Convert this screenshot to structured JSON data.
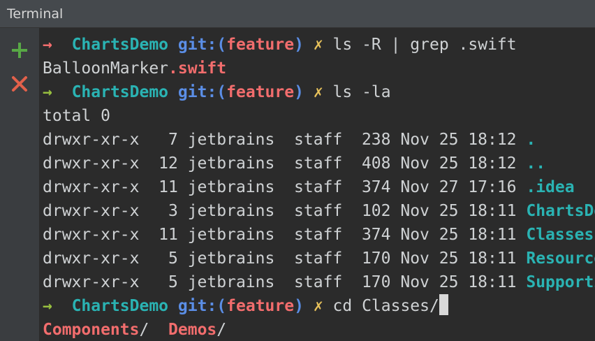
{
  "window": {
    "title": "Terminal"
  },
  "sidebar": {
    "add_icon": "plus-icon",
    "close_icon": "close-icon",
    "add_color": "#58a846",
    "close_color": "#e2614b"
  },
  "prompt": {
    "arrow": "→",
    "repo": "ChartsDemo",
    "git_label": "git:(",
    "branch": "feature",
    "git_close": ")",
    "dirty_mark": "✗"
  },
  "lines": {
    "cmd1": "ls -R | grep .swift",
    "out1_base": "BalloonMarker",
    "out1_ext": ".swift",
    "cmd2": "ls -la",
    "total": "total 0",
    "rows": [
      {
        "perms": "drwxr-xr-x   7 jetbrains  staff  238 Nov 25 18:12 ",
        "name": "."
      },
      {
        "perms": "drwxr-xr-x  12 jetbrains  staff  408 Nov 25 18:12 ",
        "name": ".."
      },
      {
        "perms": "drwxr-xr-x  11 jetbrains  staff  374 Nov 27 17:16 ",
        "name": ".idea"
      },
      {
        "perms": "drwxr-xr-x   3 jetbrains  staff  102 Nov 25 18:11 ",
        "name": "ChartsDemo"
      },
      {
        "perms": "drwxr-xr-x  11 jetbrains  staff  374 Nov 25 18:11 ",
        "name": "Classes"
      },
      {
        "perms": "drwxr-xr-x   5 jetbrains  staff  170 Nov 25 18:11 ",
        "name": "Resources"
      },
      {
        "perms": "drwxr-xr-x   5 jetbrains  staff  170 Nov 25 18:11 ",
        "name": "Supporting Files"
      }
    ],
    "cmd3": "cd Classes/",
    "completion": [
      {
        "name": "Components",
        "slash": "/"
      },
      {
        "name": "Demos",
        "slash": "/"
      }
    ]
  }
}
